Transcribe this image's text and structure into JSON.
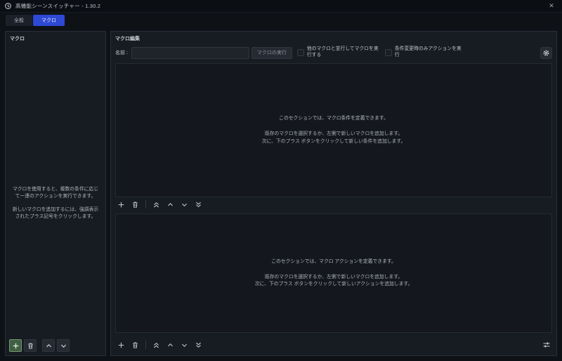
{
  "window": {
    "title": "高機能シーンスイッチャー - 1.30.2",
    "close": "✕"
  },
  "tabs": [
    {
      "label": "全般",
      "active": false
    },
    {
      "label": "マクロ",
      "active": true
    }
  ],
  "left_panel": {
    "header": "マクロ",
    "hint_paragraph_1": "マクロを使用すると、複数の条件に応じて一連のアクションを実行できます。",
    "hint_paragraph_2": "新しいマクロを追加するには、強調表示されたプラス記号をクリックします。"
  },
  "right_panel": {
    "header": "マクロ編集",
    "name_label": "名前 :",
    "name_value": "",
    "run_macro_button": "マクロの実行",
    "run_parallel_checkbox_label": "他のマクロと並行してマクロを実行する",
    "on_change_checkbox_label": "条件変更時のみアクションを実行",
    "condition_section": {
      "title_line": "このセクションでは、マクロ条件を定義できます。",
      "hint_line_1": "既存のマクロを選択するか、左側で新しいマクロを追加します。",
      "hint_line_2": "次に、下のプラス ボタンをクリックして新しい条件を追加します。"
    },
    "action_section": {
      "title_line": "このセクションでは、マクロ アクションを定義できます。",
      "hint_line_1": "既存のマクロを選択するか、左側で新しいマクロを追加します。",
      "hint_line_2": "次に、下のプラス ボタンをクリックして新しいアクションを追加します。"
    }
  },
  "icons": {
    "window_icon": "scene-switcher-clock",
    "close_icon": "✕",
    "add_icon": "+",
    "remove_icon": "trash",
    "move_top_icon": "double-chevron-up",
    "move_up_icon": "chevron-up",
    "move_down_icon": "chevron-down",
    "move_bottom_icon": "double-chevron-down",
    "settings_icon": "gear",
    "run_options_icon": "sliders"
  },
  "colors": {
    "active_tab_blue": "#2e49d4",
    "add_button_green": "#3f5e43",
    "add_button_border_green": "#74996f",
    "panel_background": "#171b22",
    "window_background": "#0e1217",
    "section_box_background": "#14181e"
  }
}
